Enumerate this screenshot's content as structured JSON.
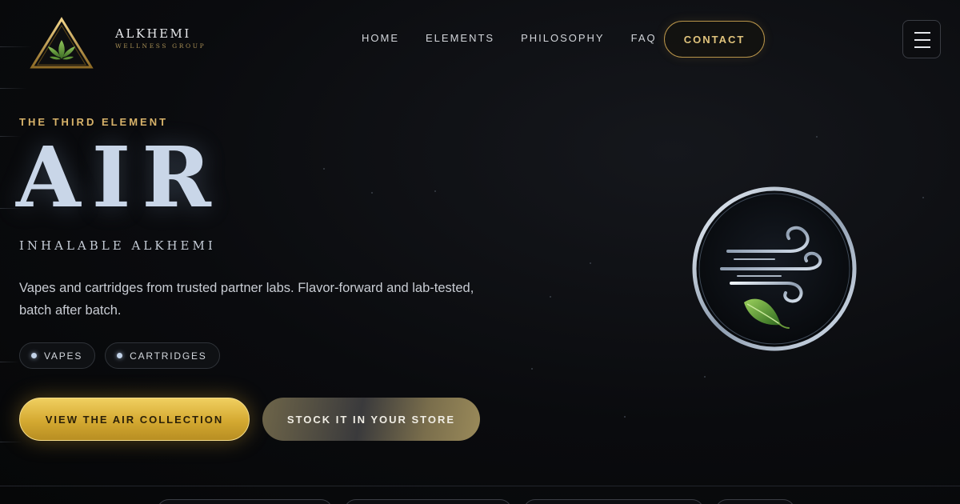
{
  "header": {
    "brand_name": "ALKHEMI",
    "brand_sub": "WELLNESS GROUP",
    "logo_icon": "triangle-leaf-logo",
    "nav": [
      {
        "label": "HOME"
      },
      {
        "label": "ELEMENTS"
      },
      {
        "label": "PHILOSOPHY"
      },
      {
        "label": "FAQ"
      }
    ],
    "contact_label": "CONTACT",
    "menu_icon": "hamburger-icon"
  },
  "hero": {
    "eyebrow": "THE THIRD ELEMENT",
    "title": "AIR",
    "subtitle": "INHALABLE ALKHEMI",
    "description": "Vapes and cartridges from trusted partner labs. Flavor-forward and lab-tested, batch after batch.",
    "tags": [
      {
        "label": "VAPES"
      },
      {
        "label": "CARTRIDGES"
      }
    ],
    "primary_cta": "VIEW THE AIR COLLECTION",
    "secondary_cta": "STOCK IT IN YOUR STORE",
    "emblem_icon": "air-wind-leaf-emblem"
  },
  "colors": {
    "accent_gold": "#d8b36a",
    "title_silver": "#c9d6e8",
    "background": "#0a0b0e"
  }
}
